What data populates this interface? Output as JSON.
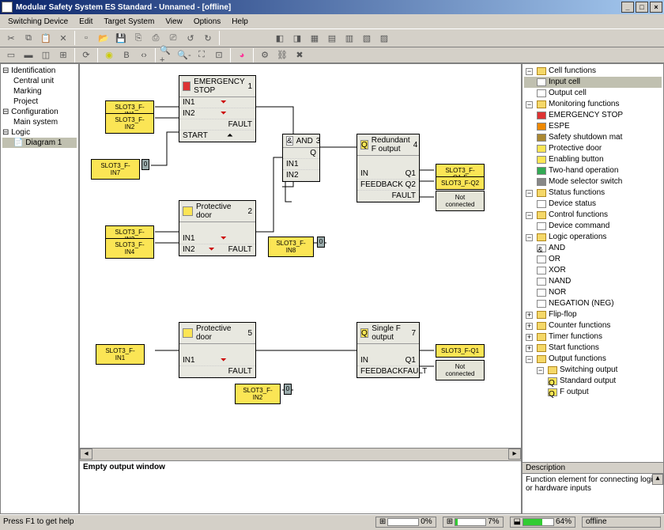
{
  "title": "Modular Safety System ES Standard - Unnamed - [offline]",
  "menu": [
    "Switching Device",
    "Edit",
    "Target System",
    "View",
    "Options",
    "Help"
  ],
  "left_tree": {
    "n0": "Identification",
    "n0a": "Central unit",
    "n0b": "Marking",
    "n0c": "Project",
    "n1": "Configuration",
    "n1a": "Main system",
    "n2": "Logic",
    "n2a": "Diagram 1"
  },
  "right_tree": {
    "g0": "Cell functions",
    "g0a": "Input cell",
    "g0b": "Output cell",
    "g1": "Monitoring functions",
    "g1a": "EMERGENCY STOP",
    "g1b": "ESPE",
    "g1c": "Safety shutdown mat",
    "g1d": "Protective door",
    "g1e": "Enabling button",
    "g1f": "Two-hand operation",
    "g1g": "Mode selector switch",
    "g2": "Status functions",
    "g2a": "Device status",
    "g3": "Control functions",
    "g3a": "Device command",
    "g4": "Logic operations",
    "g4a": "AND",
    "g4b": "OR",
    "g4c": "XOR",
    "g4d": "NAND",
    "g4e": "NOR",
    "g4f": "NEGATION (NEG)",
    "g5": "Flip-flop",
    "g6": "Counter functions",
    "g7": "Timer functions",
    "g8": "Start functions",
    "g9": "Output functions",
    "g9a": "Switching output",
    "g9aa": "Standard output",
    "g9ab": "F output"
  },
  "desc_hdr": "Description",
  "desc_body": "Function element for connecting logic or hardware inputs",
  "output_body": "Empty output window",
  "status": {
    "help": "Press F1 to get help",
    "p1": "0%",
    "p2": "7%",
    "p3": "64%",
    "mode": "offline"
  },
  "diagram": {
    "b_estop": {
      "title": "EMERGENCY STOP",
      "num": "1",
      "in1": "IN1",
      "in2": "IN2",
      "start": "START",
      "fault": "FAULT"
    },
    "b_and": {
      "title": "AND",
      "num": "3",
      "in1": "IN1",
      "in2": "IN2",
      "q": "Q"
    },
    "b_fout": {
      "title": "Redundant F output",
      "num": "4",
      "in": "IN",
      "fb": "FEEDBACK",
      "q1": "Q1",
      "q2": "Q2",
      "fault": "FAULT"
    },
    "b_pdoor2": {
      "title": "Protective door",
      "num": "2",
      "in1": "IN1",
      "in2": "IN2",
      "fault": "FAULT"
    },
    "b_pdoor5": {
      "title": "Protective door",
      "num": "5",
      "in1": "IN1",
      "fault": "FAULT"
    },
    "b_sfo": {
      "title": "Single F output",
      "num": "7",
      "in": "IN",
      "fb": "FEEDBACK",
      "q1": "Q1",
      "fault": "FAULT"
    },
    "t1": "SLOT3_F-IN1",
    "t2": "SLOT3_F-IN2",
    "t3": "SLOT3_F-IN7",
    "t4": "SLOT3_F-IN3",
    "t5": "SLOT3_F-IN4",
    "t6": "SLOT3_F-IN8",
    "t7": "SLOT3_F-Q1-F",
    "t8": "SLOT3_F-Q2",
    "t9": "Not connected",
    "t10": "SLOT3_F-IN1",
    "t11": "SLOT3_F-IN2",
    "t12": "SLOT3_F-Q1",
    "t13": "Not connected",
    "pin": "0"
  }
}
